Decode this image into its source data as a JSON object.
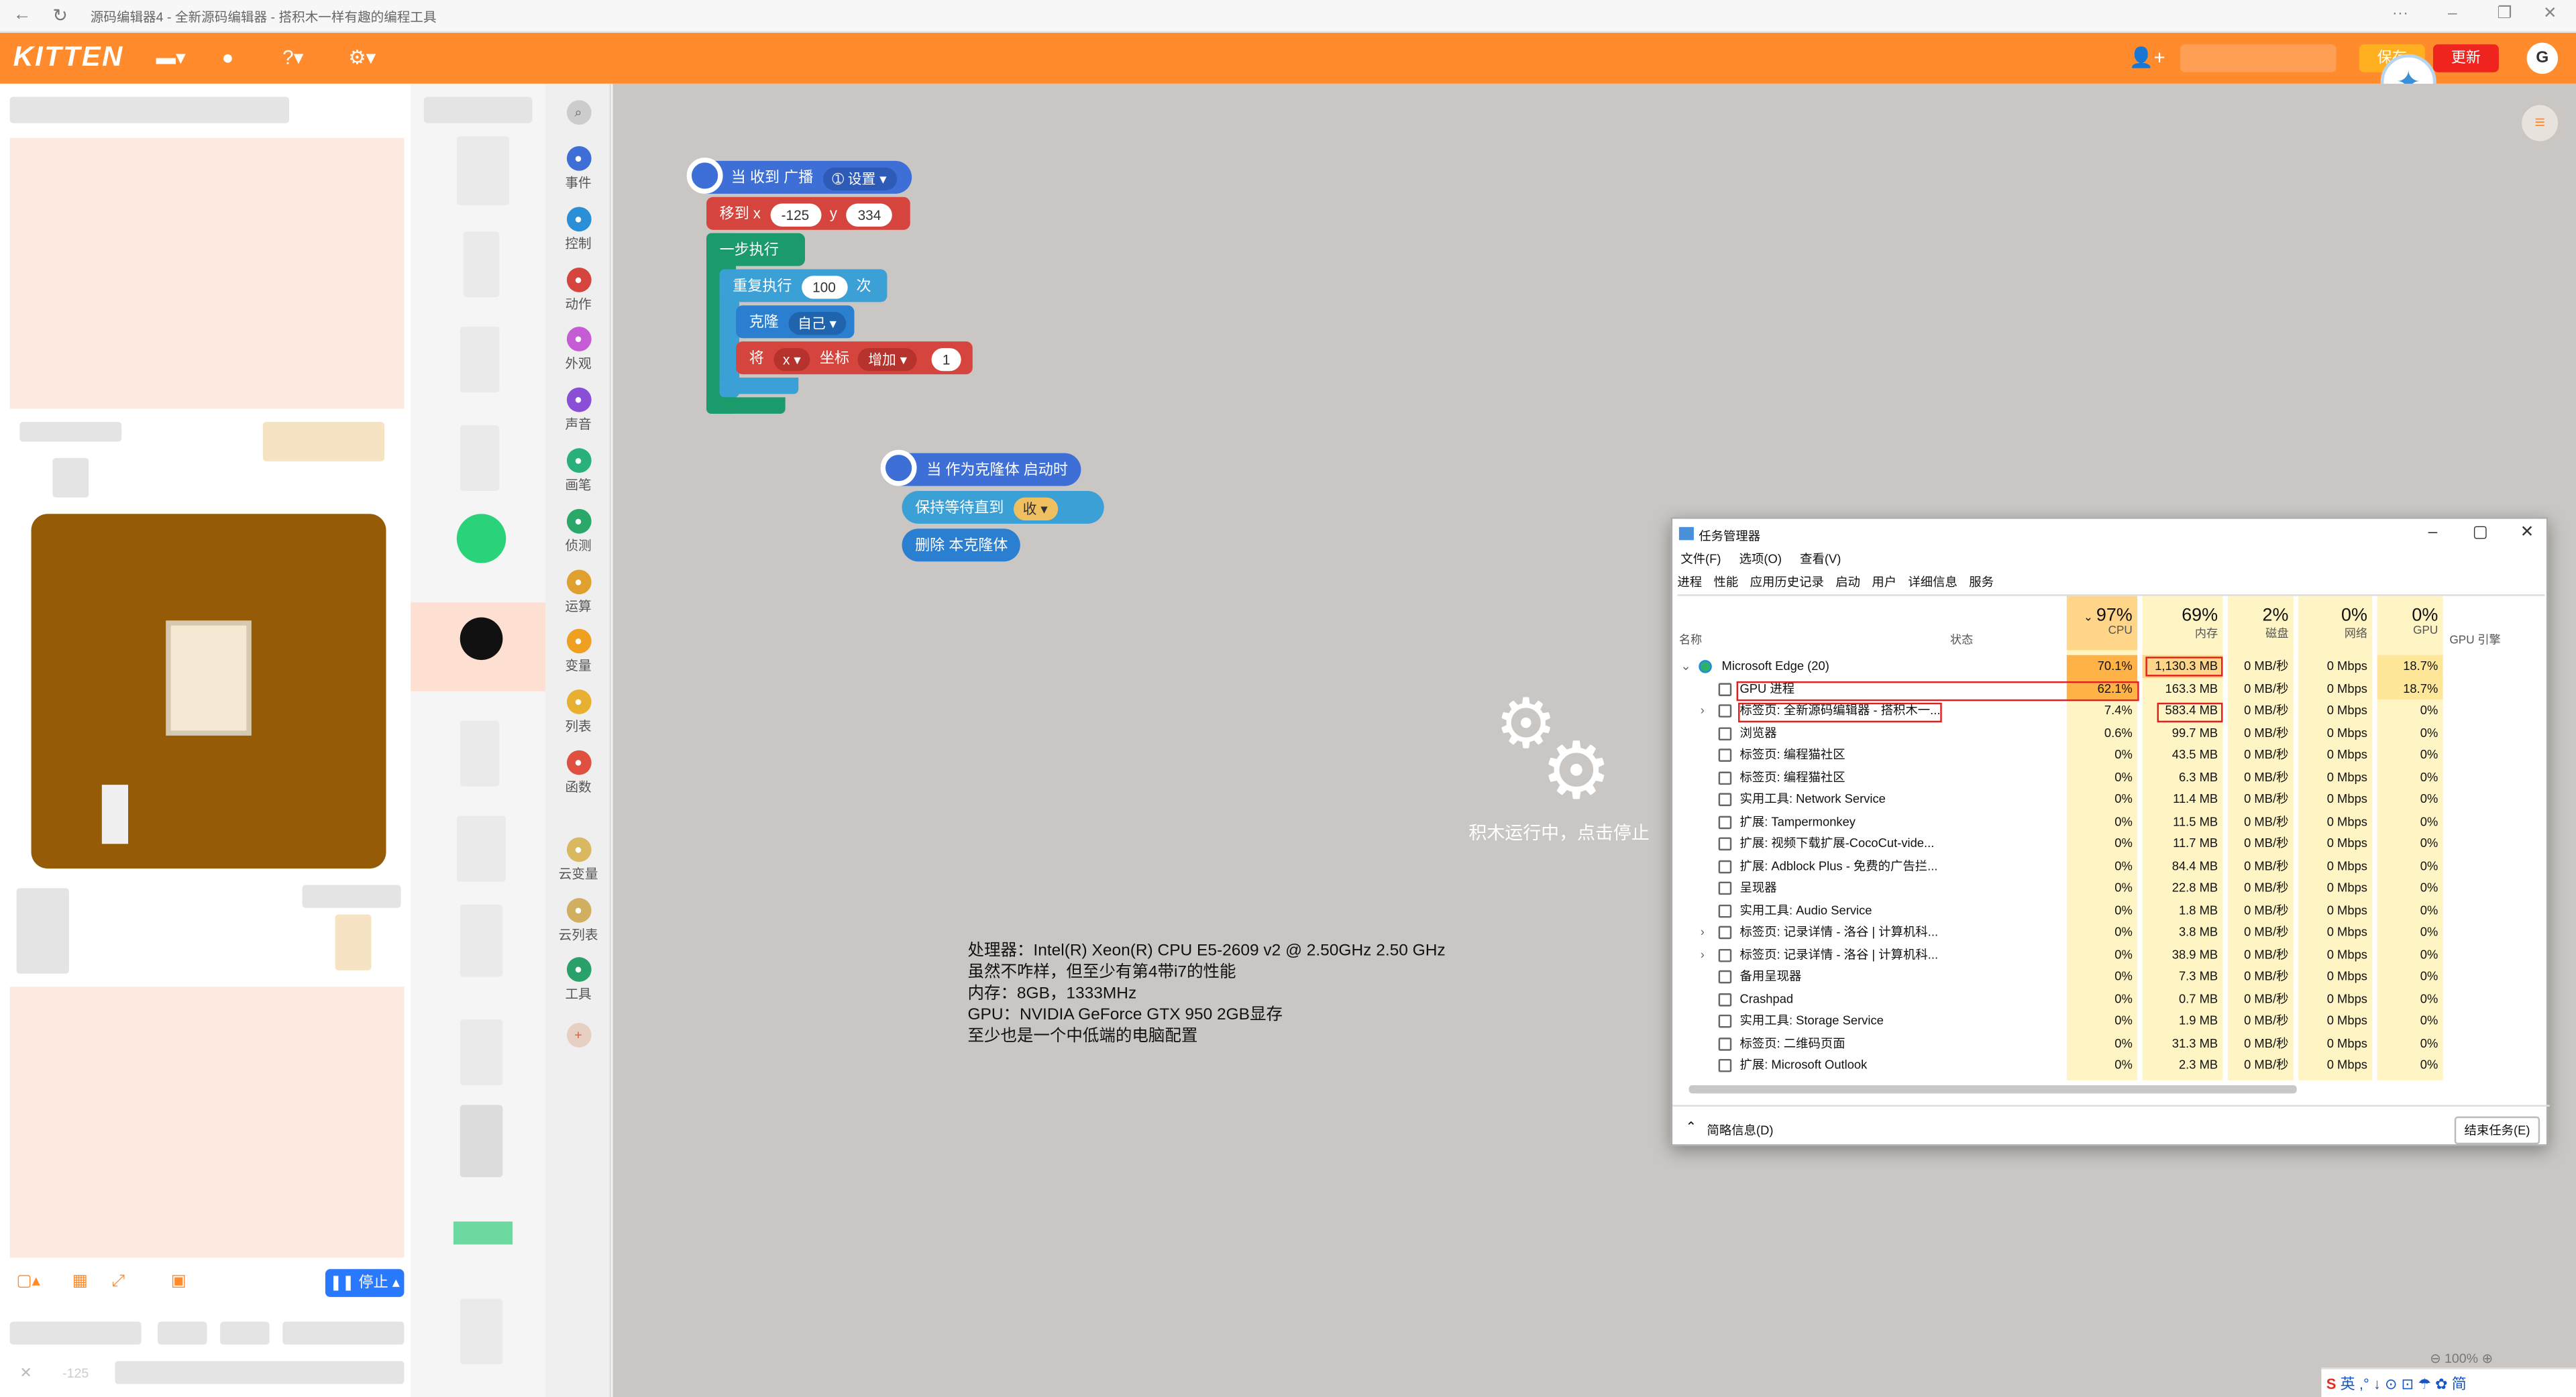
{
  "browser": {
    "title": "源码编辑器4 - 全新源码编辑器 - 搭积木一样有趣的编程工具",
    "menu_icon": "···"
  },
  "toolbar": {
    "logo": "KITTEN",
    "save_label": "保存",
    "update_label": "更新",
    "avatar_letter": "G",
    "accent": "#ff8b2c"
  },
  "stage": {
    "stop_label": "停止",
    "coord_hint": "-125"
  },
  "categories": [
    {
      "label": "事件",
      "color": "#3d6fd6"
    },
    {
      "label": "控制",
      "color": "#2a8fd6"
    },
    {
      "label": "动作",
      "color": "#d6453d"
    },
    {
      "label": "外观",
      "color": "#c65bd6"
    },
    {
      "label": "声音",
      "color": "#8a4fd6"
    },
    {
      "label": "画笔",
      "color": "#2ab07a"
    },
    {
      "label": "侦测",
      "color": "#2aa86a"
    },
    {
      "label": "运算",
      "color": "#e0a030"
    },
    {
      "label": "变量",
      "color": "#f0a020"
    },
    {
      "label": "列表",
      "color": "#e8b030"
    },
    {
      "label": "函数",
      "color": "#e05040"
    },
    {
      "label": "云变量",
      "color": "#d9b860"
    },
    {
      "label": "云列表",
      "color": "#d0b060"
    },
    {
      "label": "工具",
      "color": "#2aa06a"
    }
  ],
  "blocks": {
    "broadcast_hat": "当 收到 广播",
    "broadcast_name": "设置",
    "move_to": "移到 x",
    "x_val": "-125",
    "y_label": "y",
    "y_val": "334",
    "step_run": "一步执行",
    "repeat": "重复执行",
    "repeat_count": "100",
    "repeat_unit": "次",
    "clone": "克隆",
    "clone_target": "自己",
    "set_prefix": "将",
    "coord_var": "x",
    "coord_label": "坐标",
    "coord_op": "增加",
    "coord_amount": "1",
    "clone_hat": "当 作为克隆体 启动时",
    "wait_until": "保持等待直到",
    "wait_key": "收",
    "delete_clone": "删除 本克隆体"
  },
  "workspace": {
    "running_text": "积木运行中，点击停止",
    "specs": [
      "处理器：Intel(R) Xeon(R) CPU E5-2609 v2 @ 2.50GHz   2.50 GHz",
      "虽然不咋样，但至少有第4带i7的性能",
      "内存：8GB，1333MHz",
      "GPU：NVIDIA GeForce GTX 950 2GB显存",
      "至少也是一个中低端的电脑配置"
    ],
    "zoom": "100%"
  },
  "taskmgr": {
    "title": "任务管理器",
    "menu": [
      "文件(F)",
      "选项(O)",
      "查看(V)"
    ],
    "tabs": [
      "进程",
      "性能",
      "应用历史记录",
      "启动",
      "用户",
      "详细信息",
      "服务"
    ],
    "col_name": "名称",
    "col_status": "状态",
    "cpu_total": "97%",
    "cpu_label": "CPU",
    "mem_total": "69%",
    "mem_label": "内存",
    "disk_total": "2%",
    "disk_label": "磁盘",
    "net_total": "0%",
    "net_label": "网络",
    "gpu_total": "0%",
    "gpu_label": "GPU",
    "gpu_engine_label": "GPU 引擎",
    "rows": [
      {
        "name": "Microsoft Edge (20)",
        "cpu": "70.1%",
        "mem": "1,130.3 MB",
        "disk": "0 MB/秒",
        "net": "0 Mbps",
        "gpu": "18.7%"
      },
      {
        "name": "GPU 进程",
        "cpu": "62.1%",
        "mem": "163.3 MB",
        "disk": "0 MB/秒",
        "net": "0 Mbps",
        "gpu": "18.7%"
      },
      {
        "name": "标签页: 全新源码编辑器 - 搭积木一...",
        "cpu": "7.4%",
        "mem": "583.4 MB",
        "disk": "0 MB/秒",
        "net": "0 Mbps",
        "gpu": "0%"
      },
      {
        "name": "浏览器",
        "cpu": "0.6%",
        "mem": "99.7 MB",
        "disk": "0 MB/秒",
        "net": "0 Mbps",
        "gpu": "0%"
      },
      {
        "name": "标签页: 编程猫社区",
        "cpu": "0%",
        "mem": "43.5 MB",
        "disk": "0 MB/秒",
        "net": "0 Mbps",
        "gpu": "0%"
      },
      {
        "name": "标签页: 编程猫社区",
        "cpu": "0%",
        "mem": "6.3 MB",
        "disk": "0 MB/秒",
        "net": "0 Mbps",
        "gpu": "0%"
      },
      {
        "name": "实用工具: Network Service",
        "cpu": "0%",
        "mem": "11.4 MB",
        "disk": "0 MB/秒",
        "net": "0 Mbps",
        "gpu": "0%"
      },
      {
        "name": "扩展: Tampermonkey",
        "cpu": "0%",
        "mem": "11.5 MB",
        "disk": "0 MB/秒",
        "net": "0 Mbps",
        "gpu": "0%"
      },
      {
        "name": "扩展: 视频下载扩展-CocoCut-vide...",
        "cpu": "0%",
        "mem": "11.7 MB",
        "disk": "0 MB/秒",
        "net": "0 Mbps",
        "gpu": "0%"
      },
      {
        "name": "扩展: Adblock Plus - 免费的广告拦...",
        "cpu": "0%",
        "mem": "84.4 MB",
        "disk": "0 MB/秒",
        "net": "0 Mbps",
        "gpu": "0%"
      },
      {
        "name": "呈现器",
        "cpu": "0%",
        "mem": "22.8 MB",
        "disk": "0 MB/秒",
        "net": "0 Mbps",
        "gpu": "0%"
      },
      {
        "name": "实用工具: Audio Service",
        "cpu": "0%",
        "mem": "1.8 MB",
        "disk": "0 MB/秒",
        "net": "0 Mbps",
        "gpu": "0%"
      },
      {
        "name": "标签页: 记录详情 - 洛谷 | 计算机科...",
        "cpu": "0%",
        "mem": "3.8 MB",
        "disk": "0 MB/秒",
        "net": "0 Mbps",
        "gpu": "0%"
      },
      {
        "name": "标签页: 记录详情 - 洛谷 | 计算机科...",
        "cpu": "0%",
        "mem": "38.9 MB",
        "disk": "0 MB/秒",
        "net": "0 Mbps",
        "gpu": "0%"
      },
      {
        "name": "备用呈现器",
        "cpu": "0%",
        "mem": "7.3 MB",
        "disk": "0 MB/秒",
        "net": "0 Mbps",
        "gpu": "0%"
      },
      {
        "name": "Crashpad",
        "cpu": "0%",
        "mem": "0.7 MB",
        "disk": "0 MB/秒",
        "net": "0 Mbps",
        "gpu": "0%"
      },
      {
        "name": "实用工具: Storage Service",
        "cpu": "0%",
        "mem": "1.9 MB",
        "disk": "0 MB/秒",
        "net": "0 Mbps",
        "gpu": "0%"
      },
      {
        "name": "标签页: 二维码页面",
        "cpu": "0%",
        "mem": "31.3 MB",
        "disk": "0 MB/秒",
        "net": "0 Mbps",
        "gpu": "0%"
      },
      {
        "name": "扩展: Microsoft Outlook",
        "cpu": "0%",
        "mem": "2.3 MB",
        "disk": "0 MB/秒",
        "net": "0 Mbps",
        "gpu": "0%"
      }
    ],
    "less_details": "简略信息(D)",
    "end_task": "结束任务(E)"
  },
  "ime": {
    "text": "英 ,° ↓ ⊙ ⊡ ☂ ✿ 简"
  }
}
